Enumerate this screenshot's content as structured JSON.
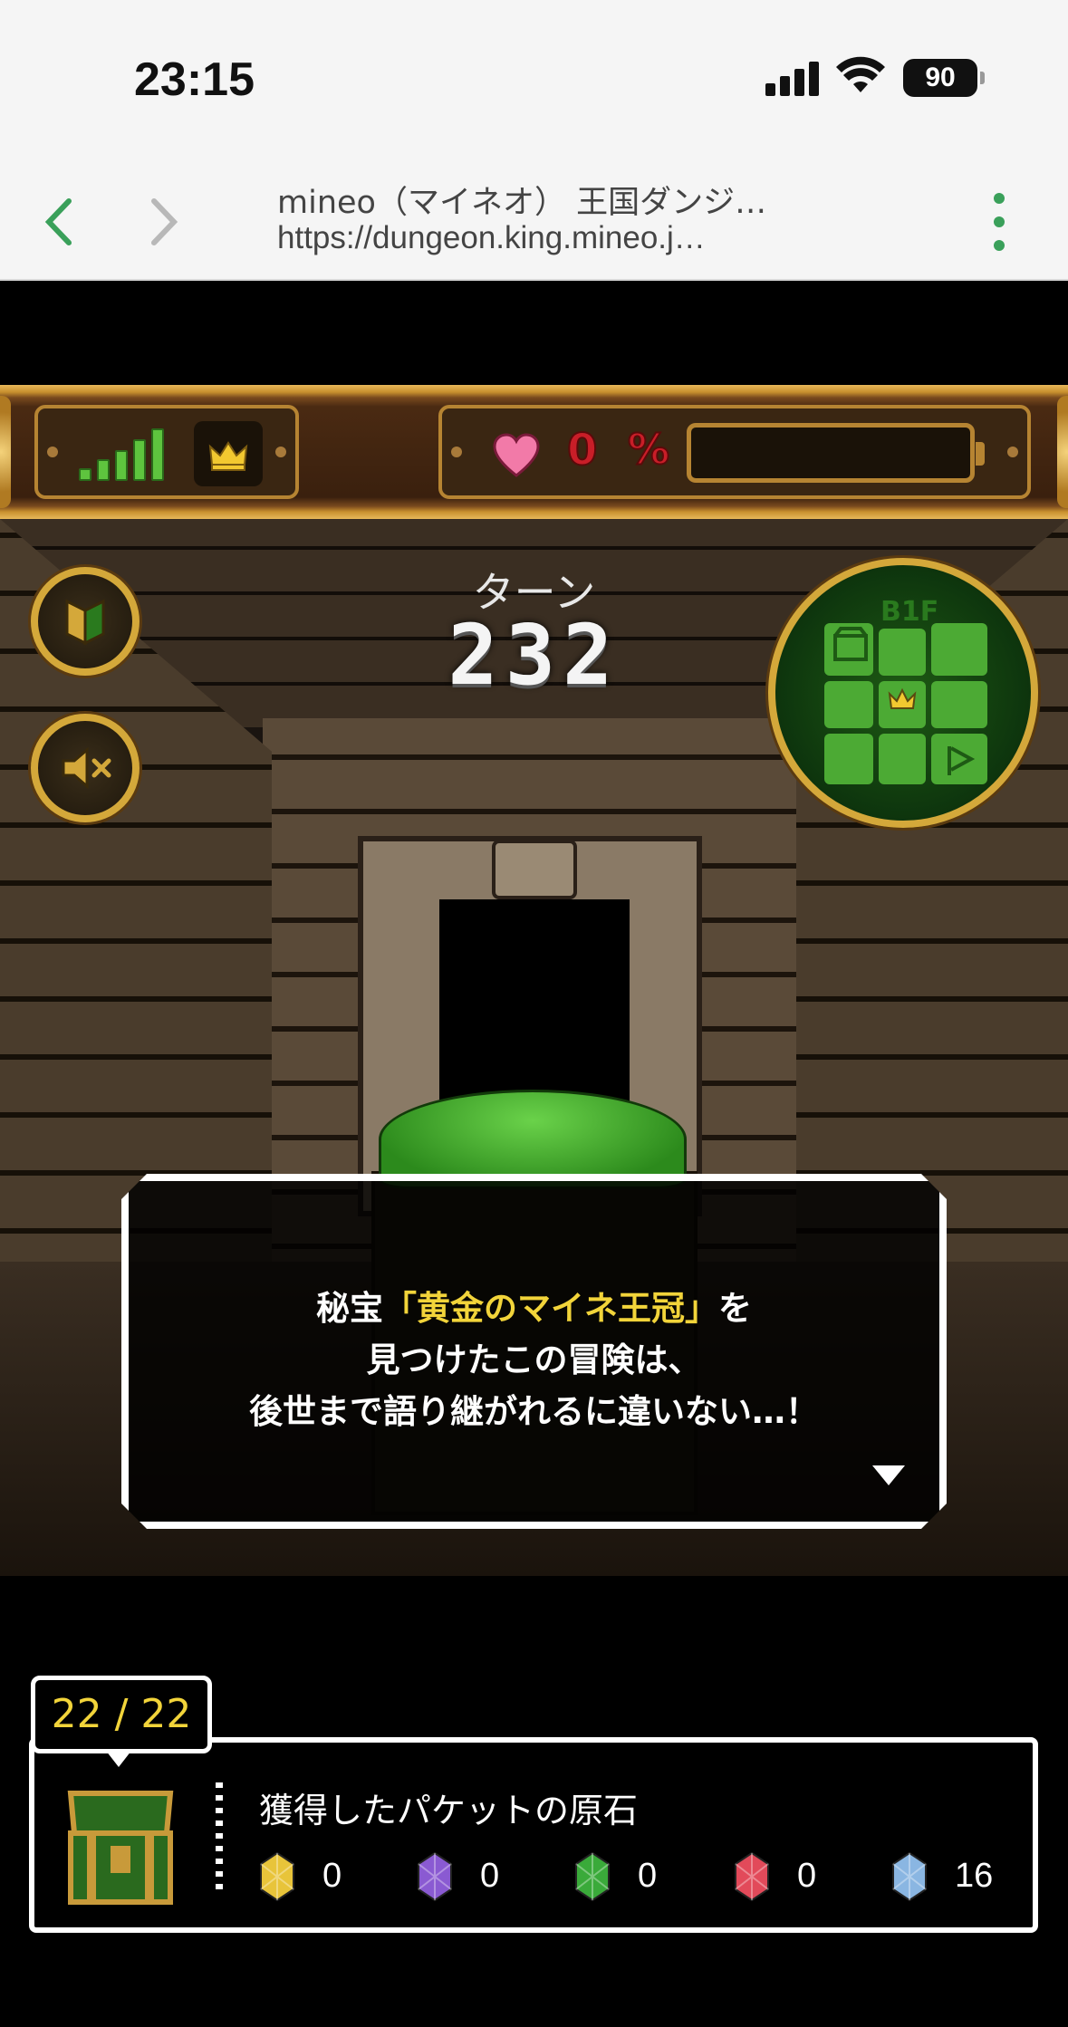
{
  "status_bar": {
    "time": "23:15",
    "battery": "90"
  },
  "browser": {
    "page_title": "mineo（マイネオ） 王国ダンジ…",
    "url": "https://dungeon.king.mineo.j…"
  },
  "hud": {
    "hp_value": "0",
    "hp_unit": "%",
    "hp_fraction": 0,
    "signal_level": 5
  },
  "game": {
    "turn_label": "ターン",
    "turn_value": "232",
    "floor_label": "B1F"
  },
  "dialog": {
    "line1_before": "秘宝",
    "line1_highlight": "「黄金のマイネ王冠」",
    "line1_after": "を",
    "line2": "見つけたこの冒険は、",
    "line3": "後世まで語り継がれるに違いない…！"
  },
  "treasure": {
    "count": "22 / 22"
  },
  "stones": {
    "title": "獲得したパケットの原石",
    "items": [
      {
        "color": "#e8c43a",
        "count": "0"
      },
      {
        "color": "#8a5ad2",
        "count": "0"
      },
      {
        "color": "#3aaa3a",
        "count": "0"
      },
      {
        "color": "#e24a5a",
        "count": "0"
      },
      {
        "color": "#8ab6e2",
        "count": "16"
      }
    ]
  },
  "colors": {
    "accent_green": "#3aa05a",
    "gold": "#d4a83a",
    "highlight": "#f2d43a"
  }
}
